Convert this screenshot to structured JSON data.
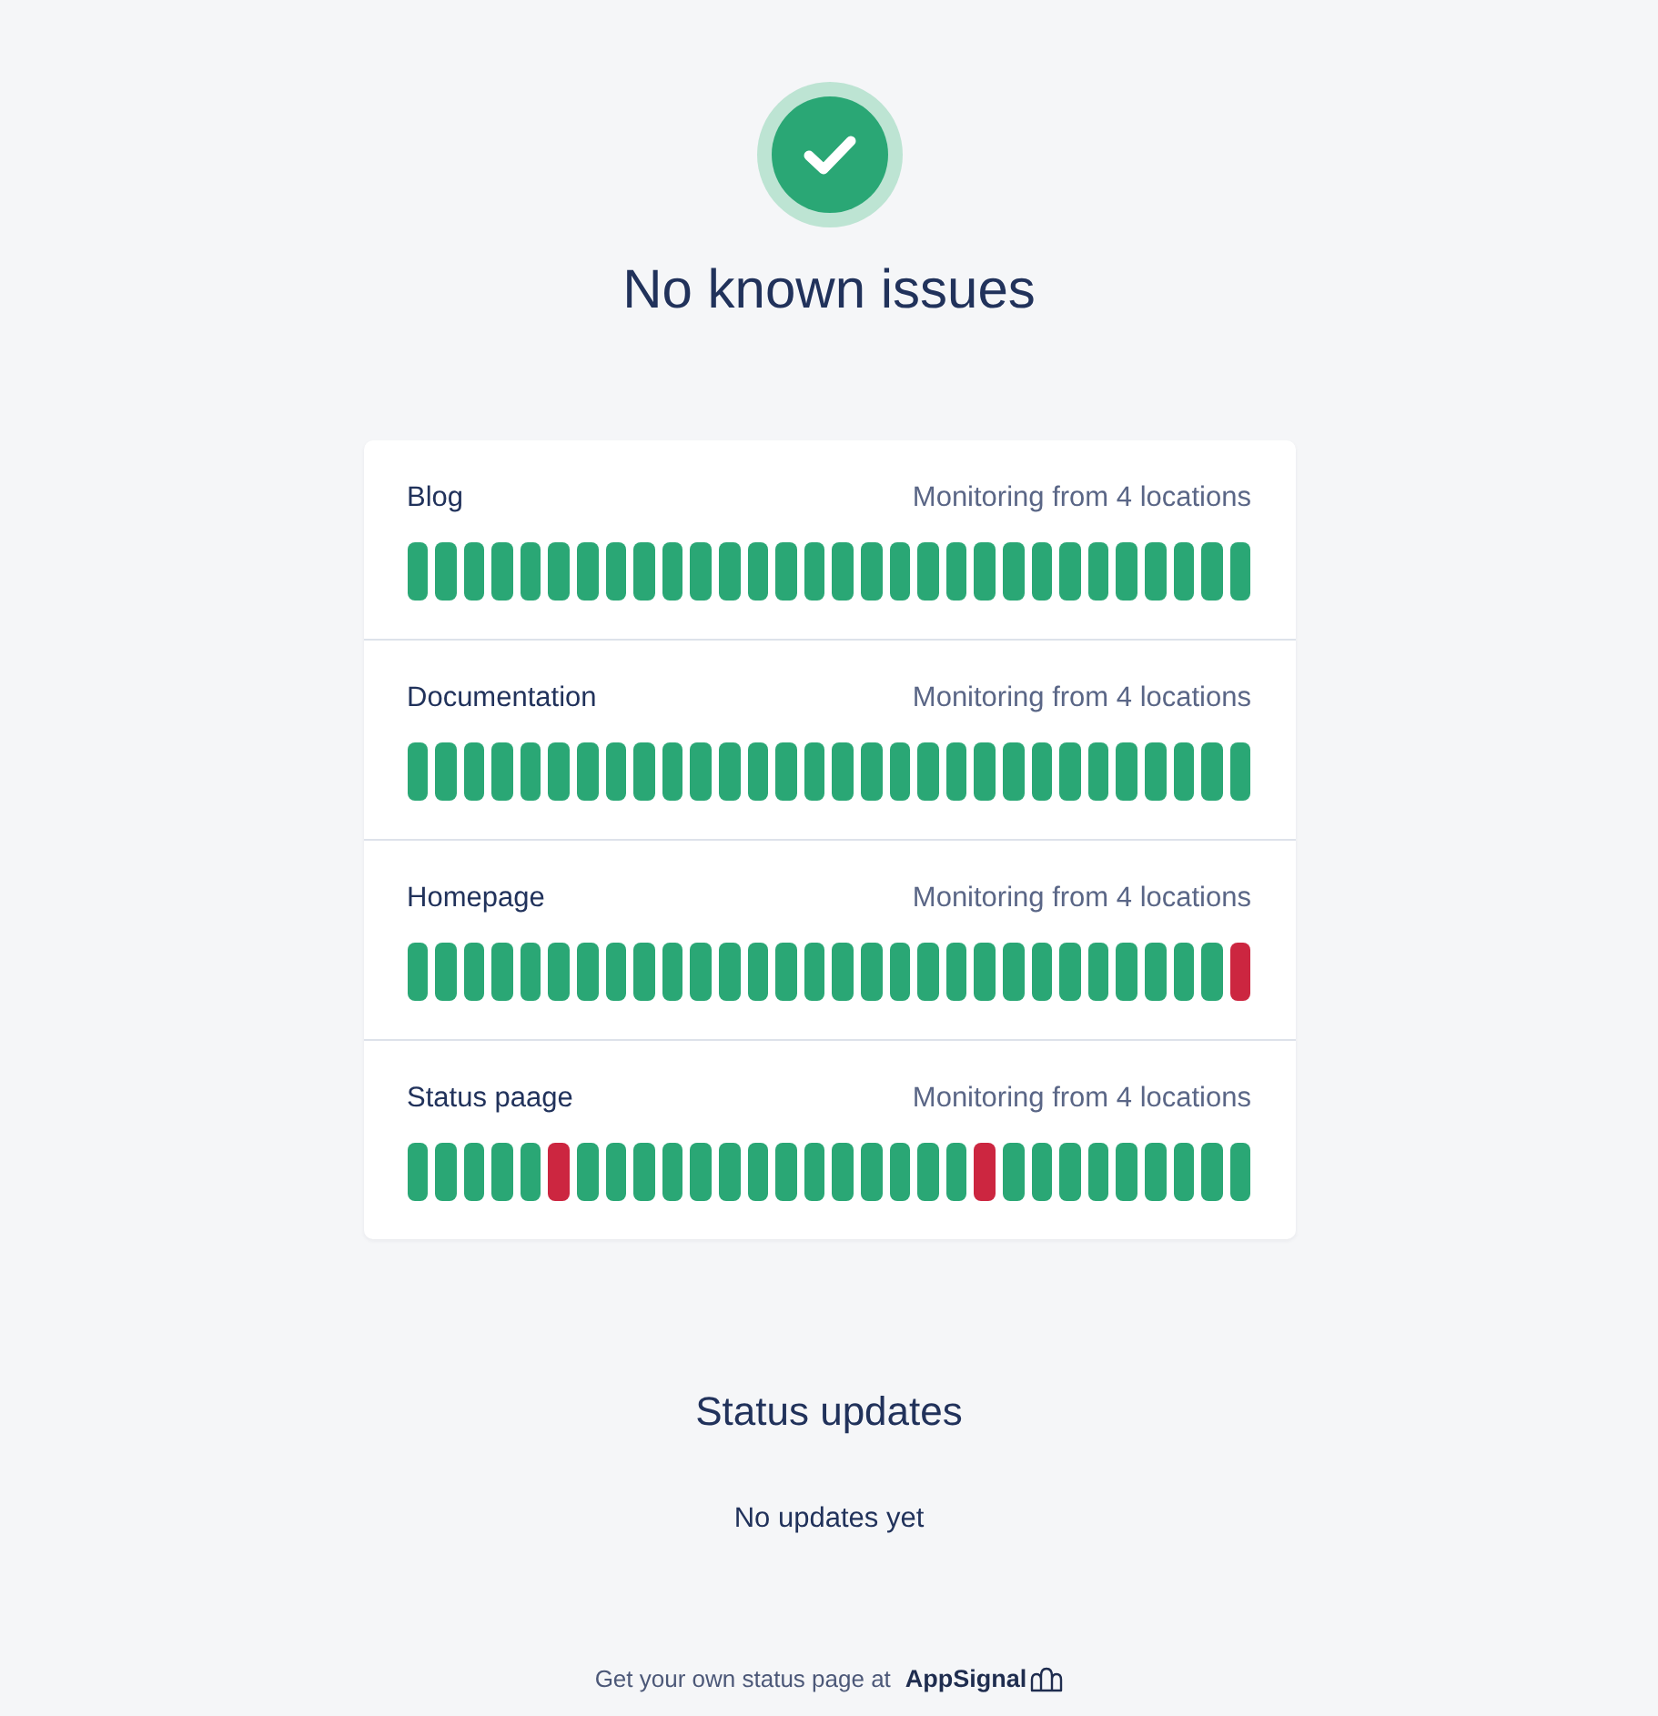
{
  "header": {
    "title": "No known issues"
  },
  "monitors": [
    {
      "name": "Blog",
      "locations": "Monitoring from 4 locations",
      "bars": [
        {
          "color": "#2aa775"
        },
        {
          "color": "#2aa775"
        },
        {
          "color": "#2aa775"
        },
        {
          "color": "#2aa775"
        },
        {
          "color": "#2aa775"
        },
        {
          "color": "#2aa775"
        },
        {
          "color": "#2aa775"
        },
        {
          "color": "#2aa775"
        },
        {
          "color": "#2aa775"
        },
        {
          "color": "#2aa775"
        },
        {
          "color": "#2aa775"
        },
        {
          "color": "#2aa775"
        },
        {
          "color": "#2aa775"
        },
        {
          "color": "#2aa775"
        },
        {
          "color": "#2aa775"
        },
        {
          "color": "#2aa775"
        },
        {
          "color": "#2aa775"
        },
        {
          "color": "#2aa775"
        },
        {
          "color": "#2aa775"
        },
        {
          "color": "#2aa775"
        },
        {
          "color": "#2aa775"
        },
        {
          "color": "#2aa775"
        },
        {
          "color": "#2aa775"
        },
        {
          "color": "#2aa775"
        },
        {
          "color": "#2aa775"
        },
        {
          "color": "#2aa775"
        },
        {
          "color": "#2aa775"
        },
        {
          "color": "#2aa775"
        },
        {
          "color": "#2aa775"
        },
        {
          "color": "#2aa775"
        }
      ]
    },
    {
      "name": "Documentation",
      "locations": "Monitoring from 4 locations",
      "bars": [
        {
          "color": "#2aa775"
        },
        {
          "color": "#2aa775"
        },
        {
          "color": "#2aa775"
        },
        {
          "color": "#2aa775"
        },
        {
          "color": "#2aa775"
        },
        {
          "color": "#2aa775"
        },
        {
          "color": "#2aa775"
        },
        {
          "color": "#2aa775"
        },
        {
          "color": "#2aa775"
        },
        {
          "color": "#2aa775"
        },
        {
          "color": "#2aa775"
        },
        {
          "color": "#2aa775"
        },
        {
          "color": "#2aa775"
        },
        {
          "color": "#2aa775"
        },
        {
          "color": "#2aa775"
        },
        {
          "color": "#2aa775"
        },
        {
          "color": "#2aa775"
        },
        {
          "color": "#2aa775"
        },
        {
          "color": "#2aa775"
        },
        {
          "color": "#2aa775"
        },
        {
          "color": "#2aa775"
        },
        {
          "color": "#2aa775"
        },
        {
          "color": "#2aa775"
        },
        {
          "color": "#2aa775"
        },
        {
          "color": "#2aa775"
        },
        {
          "color": "#2aa775"
        },
        {
          "color": "#2aa775"
        },
        {
          "color": "#2aa775"
        },
        {
          "color": "#2aa775"
        },
        {
          "color": "#2aa775"
        }
      ]
    },
    {
      "name": "Homepage",
      "locations": "Monitoring from 4 locations",
      "bars": [
        {
          "color": "#2aa775"
        },
        {
          "color": "#2aa775"
        },
        {
          "color": "#2aa775"
        },
        {
          "color": "#2aa775"
        },
        {
          "color": "#2aa775"
        },
        {
          "color": "#2aa775"
        },
        {
          "color": "#2aa775"
        },
        {
          "color": "#2aa775"
        },
        {
          "color": "#2aa775"
        },
        {
          "color": "#2aa775"
        },
        {
          "color": "#2aa775"
        },
        {
          "color": "#2aa775"
        },
        {
          "color": "#2aa775"
        },
        {
          "color": "#2aa775"
        },
        {
          "color": "#2aa775"
        },
        {
          "color": "#2aa775"
        },
        {
          "color": "#2aa775"
        },
        {
          "color": "#2aa775"
        },
        {
          "color": "#2aa775"
        },
        {
          "color": "#2aa775"
        },
        {
          "color": "#2aa775"
        },
        {
          "color": "#2aa775"
        },
        {
          "color": "#2aa775"
        },
        {
          "color": "#2aa775"
        },
        {
          "color": "#2aa775"
        },
        {
          "color": "#2aa775"
        },
        {
          "color": "#2aa775"
        },
        {
          "color": "#2aa775"
        },
        {
          "color": "#2aa775"
        },
        {
          "color": "#cc2640"
        }
      ]
    },
    {
      "name": "Status paage",
      "locations": "Monitoring from 4 locations",
      "bars": [
        {
          "color": "#2aa775"
        },
        {
          "color": "#2aa775"
        },
        {
          "color": "#2aa775"
        },
        {
          "color": "#2aa775"
        },
        {
          "color": "#2aa775"
        },
        {
          "color": "#cc2640"
        },
        {
          "color": "#2aa775"
        },
        {
          "color": "#2aa775"
        },
        {
          "color": "#2aa775"
        },
        {
          "color": "#2aa775"
        },
        {
          "color": "#2aa775"
        },
        {
          "color": "#2aa775"
        },
        {
          "color": "#2aa775"
        },
        {
          "color": "#2aa775"
        },
        {
          "color": "#2aa775"
        },
        {
          "color": "#2aa775"
        },
        {
          "color": "#2aa775"
        },
        {
          "color": "#2aa775"
        },
        {
          "color": "#2aa775"
        },
        {
          "color": "#2aa775"
        },
        {
          "color": "#cc2640"
        },
        {
          "color": "#2aa775"
        },
        {
          "color": "#2aa775"
        },
        {
          "color": "#2aa775"
        },
        {
          "color": "#2aa775"
        },
        {
          "color": "#2aa775"
        },
        {
          "color": "#2aa775"
        },
        {
          "color": "#2aa775"
        },
        {
          "color": "#2aa775"
        },
        {
          "color": "#2aa775"
        }
      ]
    }
  ],
  "updates": {
    "title": "Status updates",
    "empty_text": "No updates yet"
  },
  "footer": {
    "text": "Get your own status page at",
    "link": "AppSignal"
  }
}
